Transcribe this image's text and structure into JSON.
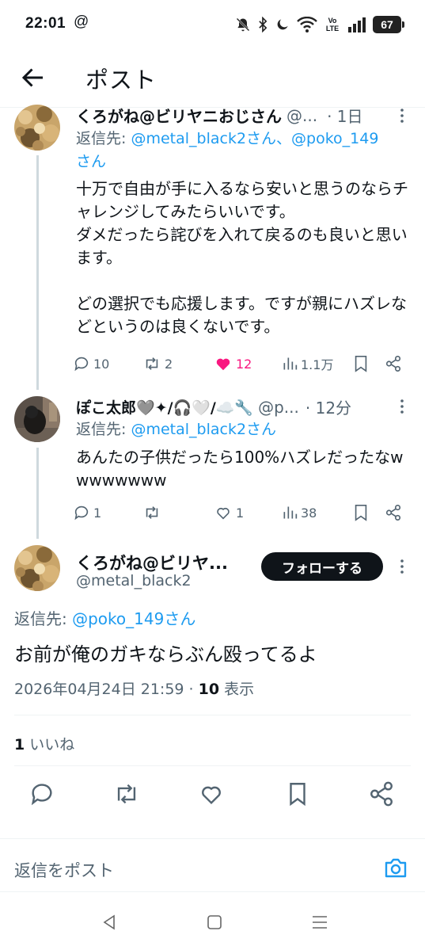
{
  "status_bar": {
    "time": "22:01",
    "at_symbol": "@",
    "wifi_label": "Vo LTE",
    "battery": "67",
    "icons": [
      "bell-off-icon",
      "bluetooth-icon",
      "moon-icon",
      "wifi-icon",
      "volte-icon",
      "signal-icon",
      "battery-icon"
    ]
  },
  "header": {
    "title": "ポスト",
    "back_icon": "arrow-left-icon"
  },
  "tweets": [
    {
      "name": "くろがね@ビリヤニおじさん",
      "handle": "@...",
      "time": "· 1日",
      "reply_prefix": "返信先: ",
      "reply_mentions": "@metal_black2さん、@poko_149",
      "reply_suffix": "さん",
      "body": "十万で自由が手に入るなら安いと思うのならチャレンジしてみたらいいです。\nダメだったら詫びを入れて戻るのも良いと思います。\n\nどの選択でも応援します。ですが親にハズレなどというのは良くないです。",
      "replies": "10",
      "retweets": "2",
      "likes": "12",
      "views": "1.1万",
      "liked": true
    },
    {
      "name": "ぽこ太郎🩶✦/🎧🤍/☁️🔧",
      "handle": "@p...",
      "time": "· 12分",
      "reply_prefix": "返信先: ",
      "reply_mentions": "@metal_black2さん",
      "reply_suffix": "",
      "body": "あんたの子供だったら100%ハズレだったなwwwwwwww",
      "replies": "1",
      "retweets": "",
      "likes": "1",
      "views": "38",
      "liked": false
    }
  ],
  "main_post": {
    "name": "くろがね@ビリヤ...",
    "handle": "@metal_black2",
    "follow_label": "フォローする",
    "reply_prefix": "返信先: ",
    "reply_mention": "@poko_149さん",
    "body": "お前が俺のガキならぶん殴ってるよ",
    "date": "2026年04月24日 21:59 · ",
    "views_count": "10",
    "views_label": " 表示",
    "like_count": "1",
    "like_label": " いいね"
  },
  "reply_bar": {
    "placeholder": "返信をポスト",
    "camera_icon": "camera-icon"
  },
  "colors": {
    "accent": "#1d9bf0",
    "like": "#f91880",
    "muted": "#536471",
    "text": "#0f1419"
  }
}
